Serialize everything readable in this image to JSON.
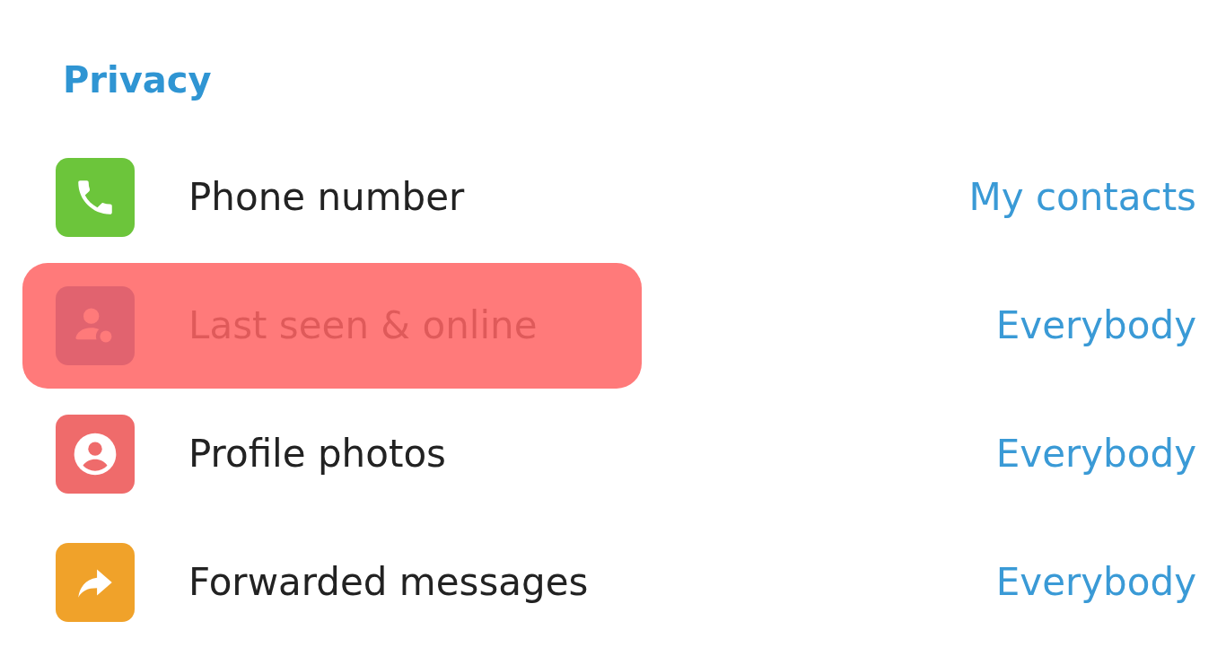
{
  "section": {
    "title": "Privacy"
  },
  "rows": [
    {
      "kind": "phone",
      "label": "Phone number",
      "value": "My contacts",
      "highlighted": false
    },
    {
      "kind": "last-seen",
      "label": "Last seen & online",
      "value": "Everybody",
      "highlighted": true
    },
    {
      "kind": "profile-photo",
      "label": "Profile photos",
      "value": "Everybody",
      "highlighted": false
    },
    {
      "kind": "forward",
      "label": "Forwarded messages",
      "value": "Everybody",
      "highlighted": false
    }
  ]
}
